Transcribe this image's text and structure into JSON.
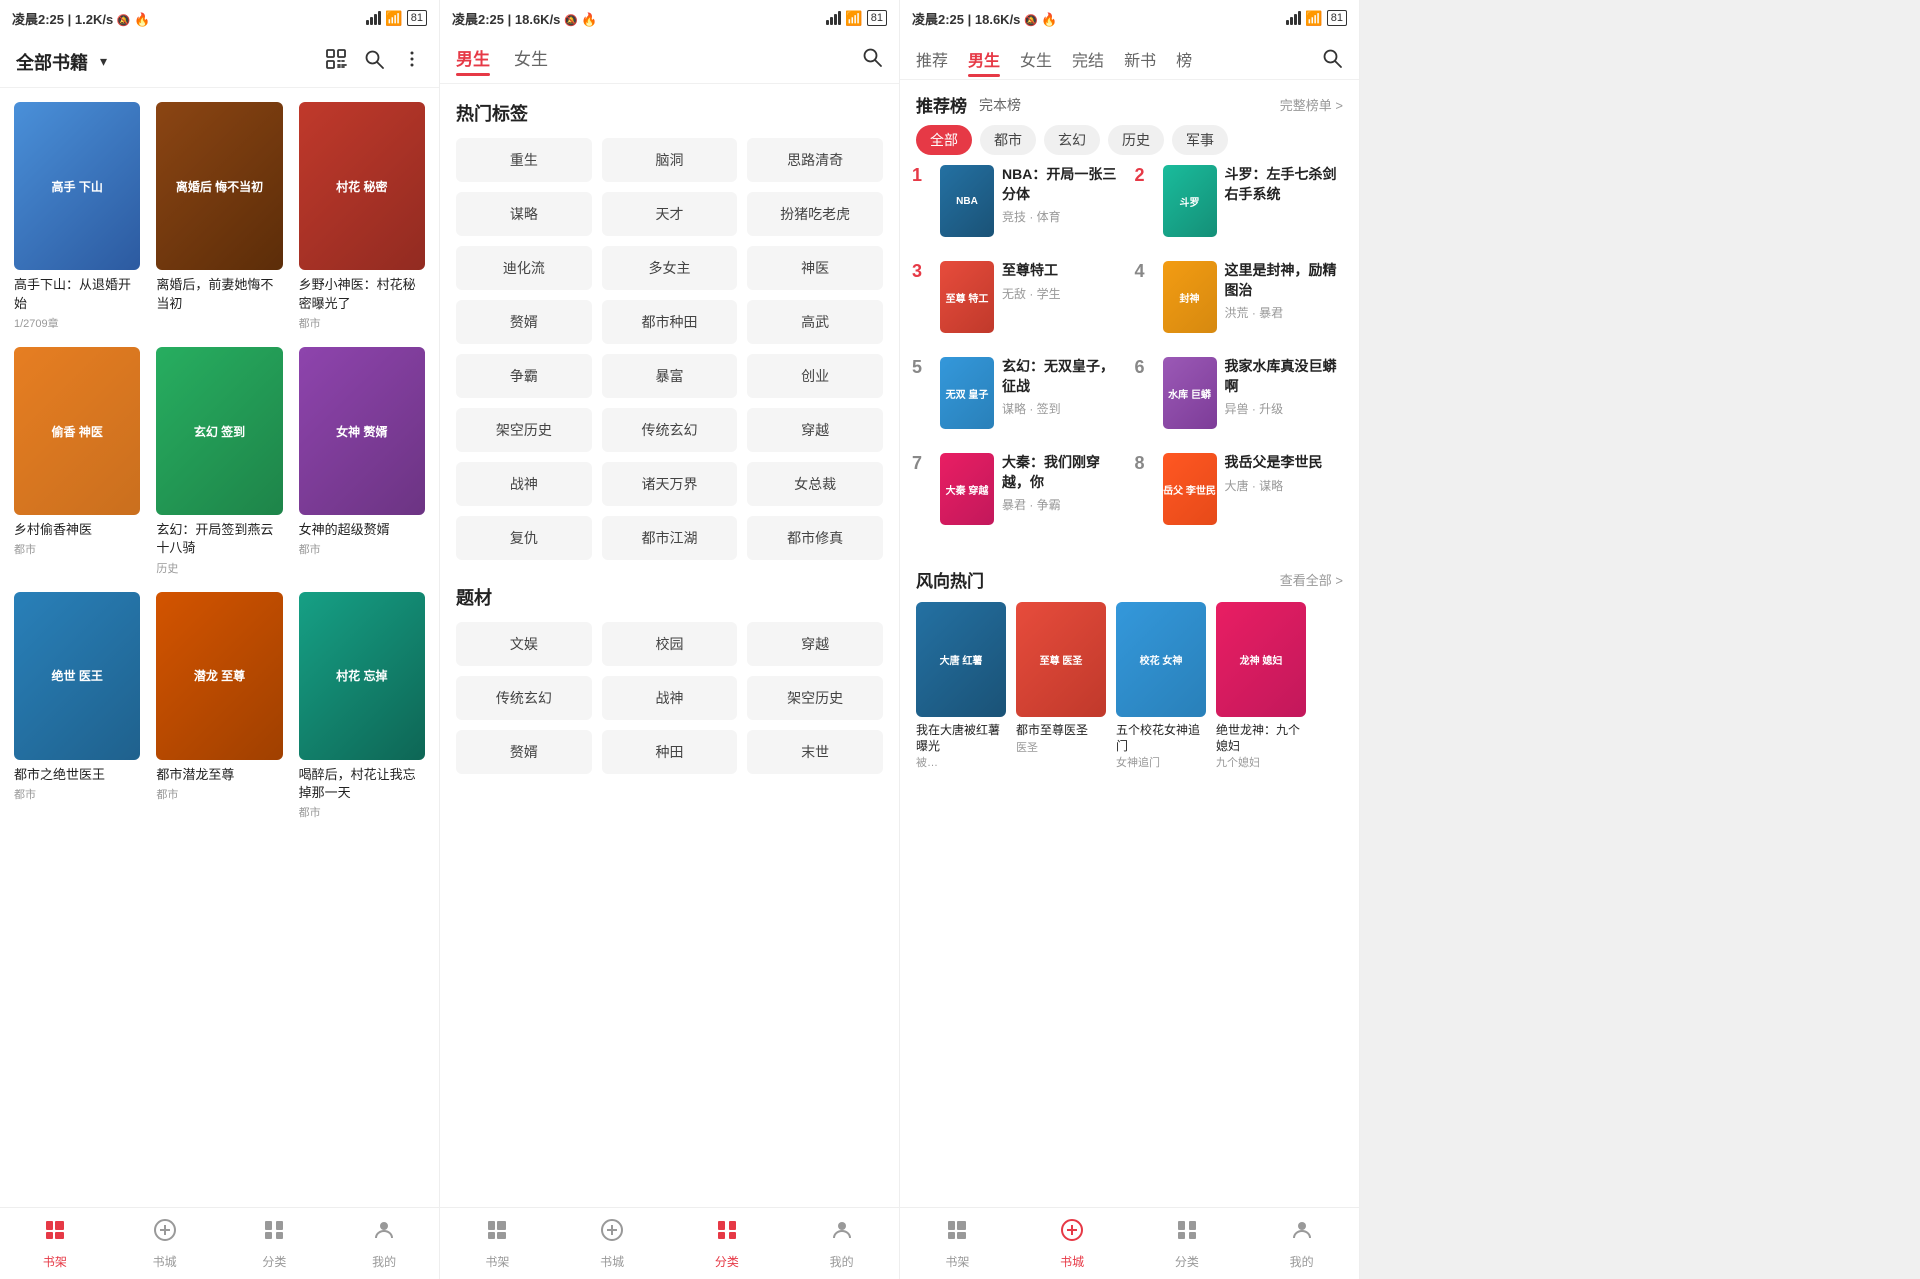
{
  "panels": [
    {
      "id": "bookshelf",
      "statusBar": {
        "time": "凌晨2:25",
        "speed": "1.2K/s",
        "battery": "81"
      },
      "header": {
        "title": "全部书籍",
        "hasArrow": true,
        "icons": [
          "scan",
          "search",
          "more"
        ]
      },
      "books": [
        {
          "id": 1,
          "title": "高手下山：从退婚开始",
          "genre": "",
          "count": "1/2709章",
          "colorClass": "c1",
          "shortTitle": "高手\n下山"
        },
        {
          "id": 2,
          "title": "离婚后，前妻她悔不当初",
          "genre": "",
          "count": "",
          "colorClass": "c2",
          "shortTitle": "离婚后\n悔不当初"
        },
        {
          "id": 3,
          "title": "乡野小神医：村花秘密曝光了",
          "genre": "都市",
          "count": "",
          "colorClass": "c3",
          "shortTitle": "村花\n秘密"
        },
        {
          "id": 4,
          "title": "乡村偷香神医",
          "genre": "都市",
          "count": "",
          "colorClass": "c4",
          "shortTitle": "偷香\n神医"
        },
        {
          "id": 5,
          "title": "玄幻：开局签到燕云十八骑",
          "genre": "历史",
          "count": "",
          "colorClass": "c5",
          "shortTitle": "玄幻\n签到"
        },
        {
          "id": 6,
          "title": "女神的超级赘婿",
          "genre": "都市",
          "count": "",
          "colorClass": "c6",
          "shortTitle": "女神\n赘婿"
        },
        {
          "id": 7,
          "title": "都市之绝世医王",
          "genre": "都市",
          "count": "",
          "colorClass": "c7",
          "shortTitle": "绝世\n医王"
        },
        {
          "id": 8,
          "title": "都市潜龙至尊",
          "genre": "都市",
          "count": "",
          "colorClass": "c8",
          "shortTitle": "潜龙\n至尊"
        },
        {
          "id": 9,
          "title": "喝醉后，村花让我忘掉那一天",
          "genre": "都市",
          "count": "",
          "colorClass": "c9",
          "shortTitle": "村花\n忘掉"
        }
      ],
      "bottomNav": [
        {
          "label": "书架",
          "icon": "📚",
          "active": true
        },
        {
          "label": "书城",
          "icon": "🏪",
          "active": false
        },
        {
          "label": "分类",
          "icon": "⊞",
          "active": false
        },
        {
          "label": "我的",
          "icon": "👤",
          "active": false
        }
      ]
    },
    {
      "id": "category",
      "statusBar": {
        "time": "凌晨2:25",
        "speed": "18.6K/s",
        "battery": "81"
      },
      "tabs": [
        {
          "label": "男生",
          "active": true
        },
        {
          "label": "女生",
          "active": false
        }
      ],
      "hotTags": {
        "sectionTitle": "热门标签",
        "tags": [
          "重生",
          "脑洞",
          "思路清奇",
          "谋略",
          "天才",
          "扮猪吃老虎",
          "迪化流",
          "多女主",
          "神医",
          "赘婿",
          "都市种田",
          "高武",
          "争霸",
          "暴富",
          "创业",
          "架空历史",
          "传统玄幻",
          "穿越",
          "战神",
          "诸天万界",
          "女总裁",
          "复仇",
          "都市江湖",
          "都市修真"
        ]
      },
      "subjects": {
        "sectionTitle": "题材",
        "tags": [
          "文娱",
          "校园",
          "穿越",
          "传统玄幻",
          "战神",
          "架空历史",
          "赘婿",
          "种田",
          "末世"
        ]
      },
      "bottomNav": [
        {
          "label": "书架",
          "icon": "📚",
          "active": false
        },
        {
          "label": "书城",
          "icon": "🏪",
          "active": false
        },
        {
          "label": "分类",
          "icon": "⊞",
          "active": true
        },
        {
          "label": "我的",
          "icon": "👤",
          "active": false
        }
      ]
    },
    {
      "id": "rankings",
      "statusBar": {
        "time": "凌晨2:25",
        "speed": "18.6K/s",
        "battery": "81"
      },
      "topTabs": [
        {
          "label": "推荐",
          "active": false
        },
        {
          "label": "男生",
          "active": true
        },
        {
          "label": "女生",
          "active": false
        },
        {
          "label": "完结",
          "active": false
        },
        {
          "label": "新书",
          "active": false
        },
        {
          "label": "榜",
          "active": false
        }
      ],
      "rankList": {
        "sectionTitle": "推荐榜",
        "subTitle": "完本榜",
        "viewAllLabel": "完整榜单 >",
        "filterPills": [
          "全部",
          "都市",
          "玄幻",
          "历史",
          "军事"
        ],
        "activePill": "全部",
        "items": [
          {
            "rank": 1,
            "title": "NBA：开局一张三分体",
            "tags": "竞技 · 体育",
            "colorClass": "c11",
            "shortTitle": "NBA"
          },
          {
            "rank": 2,
            "title": "斗罗：左手七杀剑右手系统",
            "tags": "",
            "colorClass": "c12",
            "shortTitle": "斗罗"
          },
          {
            "rank": 3,
            "title": "至尊特工",
            "tags": "无敌 · 学生",
            "colorClass": "c13",
            "shortTitle": "至尊\n特工"
          },
          {
            "rank": 4,
            "title": "这里是封神，励精图治",
            "tags": "洪荒 · 暴君",
            "colorClass": "c14",
            "shortTitle": "封神"
          },
          {
            "rank": 5,
            "title": "玄幻：无双皇子，征战",
            "tags": "谋略 · 签到",
            "colorClass": "c15",
            "shortTitle": "无双\n皇子"
          },
          {
            "rank": 6,
            "title": "我家水库真没巨蟒啊",
            "tags": "异兽 · 升级",
            "colorClass": "c16",
            "shortTitle": "水库\n巨蟒"
          },
          {
            "rank": 7,
            "title": "大秦：我们刚穿越，你",
            "tags": "暴君 · 争霸",
            "colorClass": "c17",
            "shortTitle": "大秦\n穿越"
          },
          {
            "rank": 8,
            "title": "我岳父是李世民",
            "tags": "大唐 · 谋略",
            "colorClass": "c18",
            "shortTitle": "岳父\n李世民"
          }
        ]
      },
      "hotSection": {
        "title": "风向热门",
        "viewAllLabel": "查看全部 >",
        "books": [
          {
            "title": "我在大唐被红薯曝光",
            "sub": "被…",
            "colorClass": "c11",
            "shortTitle": "大唐\n红薯"
          },
          {
            "title": "都市至尊医圣",
            "sub": "医圣",
            "colorClass": "c13",
            "shortTitle": "至尊\n医圣"
          },
          {
            "title": "五个校花女神追门",
            "sub": "女神追门",
            "colorClass": "c15",
            "shortTitle": "校花\n女神"
          },
          {
            "title": "绝世龙神：九个媳妇",
            "sub": "九个媳妇",
            "colorClass": "c17",
            "shortTitle": "龙神\n媳妇"
          }
        ]
      },
      "bottomNav": [
        {
          "label": "书架",
          "icon": "📚",
          "active": false
        },
        {
          "label": "书城",
          "icon": "🏪",
          "active": true
        },
        {
          "label": "分类",
          "icon": "⊞",
          "active": false
        },
        {
          "label": "我的",
          "icon": "👤",
          "active": false
        }
      ]
    }
  ]
}
